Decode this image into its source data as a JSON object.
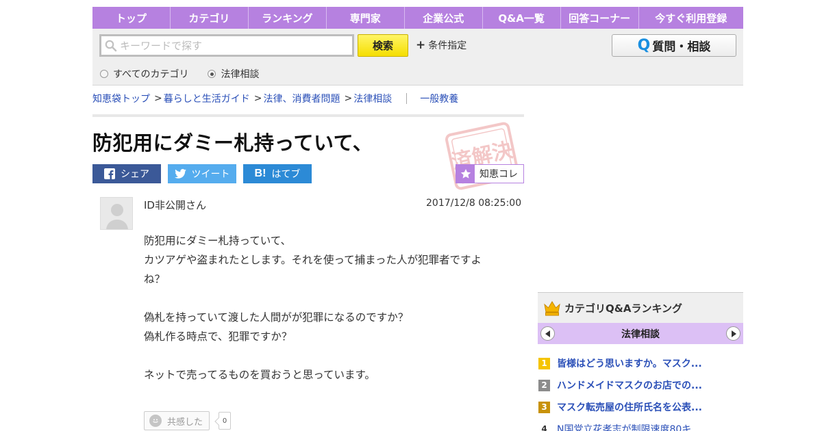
{
  "nav": {
    "items": [
      "トップ",
      "カテゴリ",
      "ランキング",
      "専門家",
      "企業公式",
      "Q&A一覧",
      "回答コーナー",
      "今すぐ利用登録"
    ]
  },
  "search": {
    "placeholder": "キーワードで探す",
    "button_label": "検索",
    "condition_label": "条件指定",
    "scope_all": "すべてのカテゴリ",
    "scope_current": "法律相談",
    "ask_label": "質問・相談"
  },
  "breadcrumb": {
    "items": [
      "知恵袋トップ",
      "暮らしと生活ガイド",
      "法律、消費者問題",
      "法律相談"
    ],
    "separator": ">",
    "extra": "一般教養"
  },
  "question": {
    "title": "防犯用にダミー札持っていて、",
    "user": "ID非公開さん",
    "datetime": "2017/12/8  08:25:00",
    "body": [
      "防犯用にダミー札持っていて、",
      "カツアゲや盗まれたとします。それを使って捕まった人が犯罪者ですよ",
      "ね？",
      "",
      "偽札を持っていて渡した人間がが犯罪になるのですか？",
      "偽札作る時点で、犯罪ですか？",
      "",
      "ネットで売ってるものを買おうと思っています。"
    ],
    "empathy_label": "共感した",
    "empathy_count": "0",
    "stamp_text": "済解決"
  },
  "share": {
    "facebook": "シェア",
    "twitter": "ツイート",
    "hatena": "はてブ",
    "hatena_mark": "B!",
    "chiekore": "知恵コレ"
  },
  "ranking": {
    "heading": "カテゴリQ&Aランキング",
    "category": "法律相談",
    "items": [
      {
        "rank": "1",
        "text": "皆様はどう思いますか。マスク..."
      },
      {
        "rank": "2",
        "text": "ハンドメイドマスクのお店での..."
      },
      {
        "rank": "3",
        "text": "マスク転売屋の住所氏名を公表..."
      },
      {
        "rank": "4",
        "text": "N国党立花孝志が制限速度80キ..."
      }
    ]
  },
  "colors": {
    "brand_purple": "#b681e0",
    "link_blue": "#2b50b8",
    "search_yellow": "#f5de00",
    "facebook": "#3b5998",
    "twitter": "#55acee",
    "hatena": "#2c8ad6",
    "rank_gold": "#f5c400",
    "rank_silver": "#8c8c8c",
    "rank_bronze": "#c8920a",
    "stamp_red": "#d63a3a"
  }
}
